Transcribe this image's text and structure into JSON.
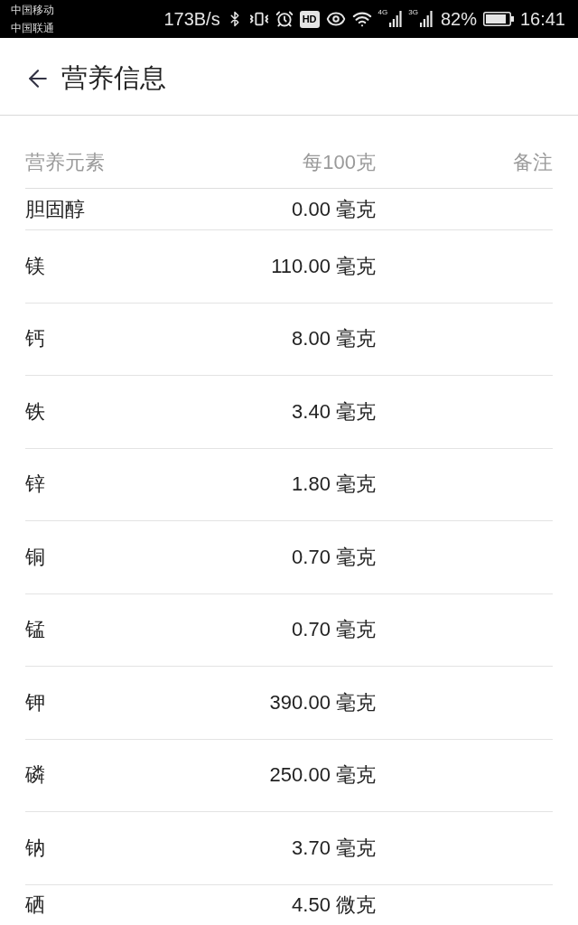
{
  "status_bar": {
    "carriers": [
      "中国移动",
      "中国联通"
    ],
    "net_speed": "173B/s",
    "hd_label": "HD",
    "signals": [
      {
        "network": "4G"
      },
      {
        "network": "3G"
      }
    ],
    "battery_percent": "82%",
    "time": "16:41"
  },
  "app_bar": {
    "title": "营养信息"
  },
  "table": {
    "columns": [
      "营养元素",
      "每100克",
      "备注"
    ],
    "rows": [
      {
        "nutrient": "胆固醇",
        "per_100g": "0.00 毫克"
      },
      {
        "nutrient": "镁",
        "per_100g": "110.00 毫克"
      },
      {
        "nutrient": "钙",
        "per_100g": "8.00 毫克"
      },
      {
        "nutrient": "铁",
        "per_100g": "3.40 毫克"
      },
      {
        "nutrient": "锌",
        "per_100g": "1.80 毫克"
      },
      {
        "nutrient": "铜",
        "per_100g": "0.70 毫克"
      },
      {
        "nutrient": "锰",
        "per_100g": "0.70 毫克"
      },
      {
        "nutrient": "钾",
        "per_100g": "390.00 毫克"
      },
      {
        "nutrient": "磷",
        "per_100g": "250.00 毫克"
      },
      {
        "nutrient": "钠",
        "per_100g": "3.70 毫克"
      },
      {
        "nutrient": "硒",
        "per_100g": "4.50 微克"
      }
    ]
  }
}
